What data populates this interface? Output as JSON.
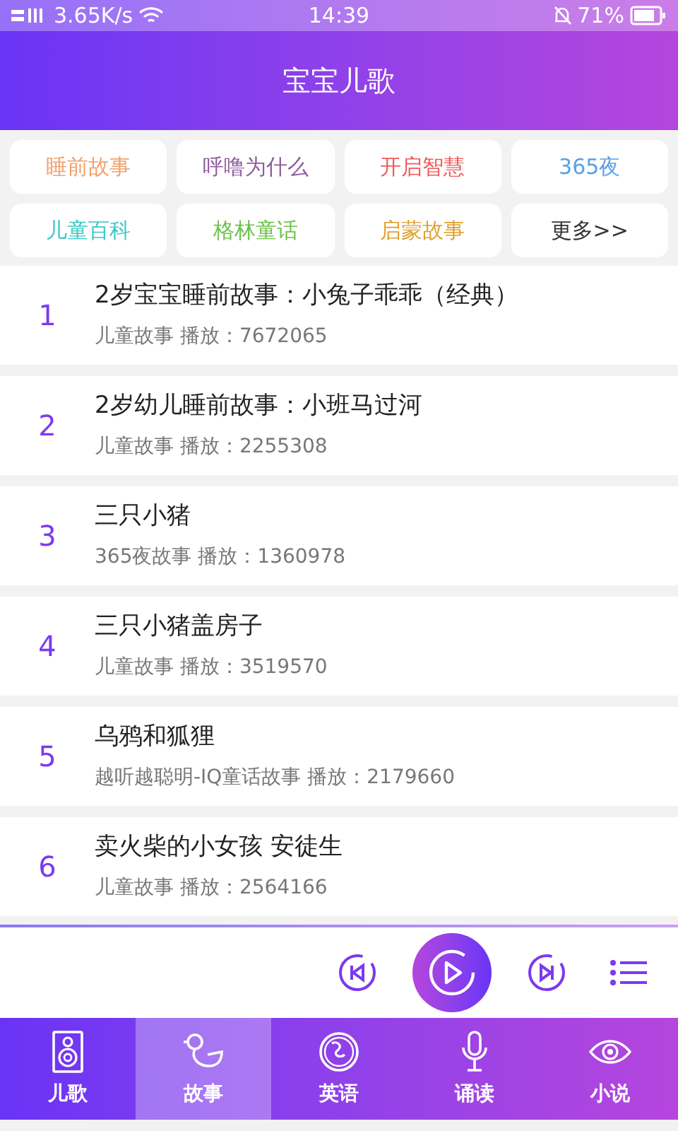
{
  "status_bar": {
    "network": "3.65K/s",
    "time": "14:39",
    "battery": "71%"
  },
  "header": {
    "title": "宝宝儿歌"
  },
  "categories": [
    {
      "label": "睡前故事",
      "color": "#f5a06a"
    },
    {
      "label": "呼噜为什么",
      "color": "#8e5a9e"
    },
    {
      "label": "开启智慧",
      "color": "#ef5a5a"
    },
    {
      "label": "365夜",
      "color": "#5aa0e6"
    },
    {
      "label": "儿童百科",
      "color": "#3cc7c7"
    },
    {
      "label": "格林童话",
      "color": "#6cc24a"
    },
    {
      "label": "启蒙故事",
      "color": "#e0a030"
    },
    {
      "label": "更多>>",
      "color": "#333333"
    }
  ],
  "stories": [
    {
      "rank": "1",
      "title": "2岁宝宝睡前故事：小兔子乖乖（经典）",
      "meta": "儿童故事 播放：7672065"
    },
    {
      "rank": "2",
      "title": "2岁幼儿睡前故事：小班马过河",
      "meta": "儿童故事 播放：2255308"
    },
    {
      "rank": "3",
      "title": "三只小猪",
      "meta": "365夜故事 播放：1360978"
    },
    {
      "rank": "4",
      "title": "三只小猪盖房子",
      "meta": "儿童故事 播放：3519570"
    },
    {
      "rank": "5",
      "title": "乌鸦和狐狸",
      "meta": "越听越聪明-IQ童话故事 播放：2179660"
    },
    {
      "rank": "6",
      "title": "卖火柴的小女孩 安徒生",
      "meta": "儿童故事 播放：2564166"
    }
  ],
  "tabs": [
    {
      "label": "儿歌",
      "kind": "speaker",
      "selected": false
    },
    {
      "label": "故事",
      "kind": "duck",
      "selected": true
    },
    {
      "label": "英语",
      "kind": "globe",
      "selected": false
    },
    {
      "label": "诵读",
      "kind": "mic",
      "selected": false
    },
    {
      "label": "小说",
      "kind": "eye",
      "selected": false
    }
  ]
}
